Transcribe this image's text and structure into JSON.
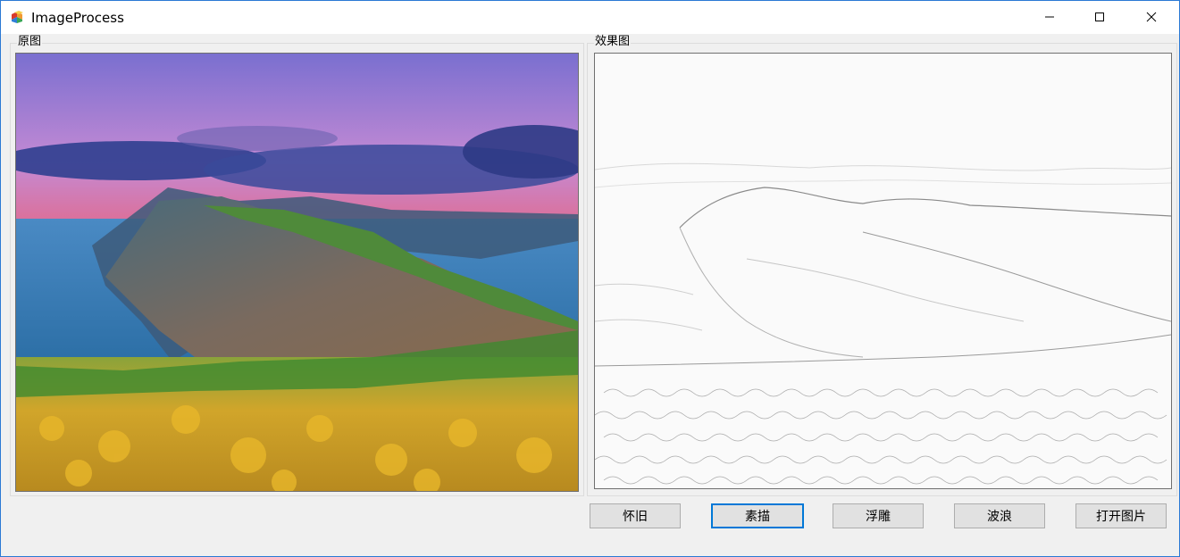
{
  "window": {
    "title": "ImageProcess",
    "icon": "app-cube-icon",
    "controls": {
      "minimize_icon": "minimize-icon",
      "maximize_icon": "maximize-icon",
      "close_icon": "close-icon"
    }
  },
  "original": {
    "group_label": "原图"
  },
  "effect": {
    "group_label": "效果图"
  },
  "buttons": {
    "nostalgia": "怀旧",
    "sketch": "素描",
    "emboss": "浮雕",
    "wave": "波浪",
    "open_image": "打开图片"
  },
  "colors": {
    "accent": "#0078d7",
    "window_border": "#2b79d4",
    "button_bg": "#e1e1e1"
  }
}
